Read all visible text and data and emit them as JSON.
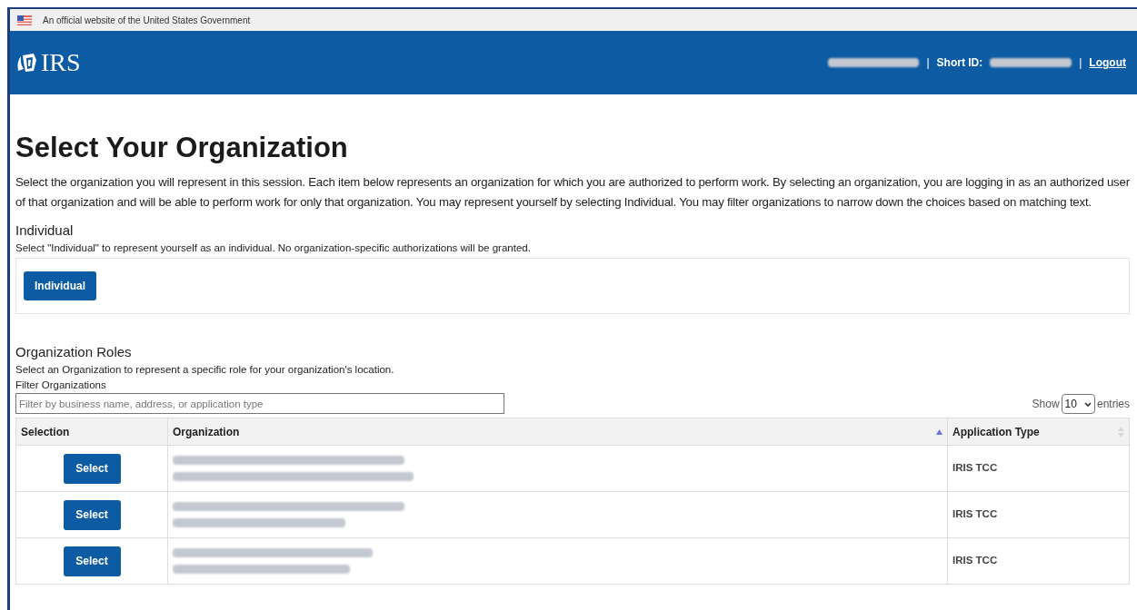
{
  "gov_banner": {
    "text": "An official website of the United States Government"
  },
  "header": {
    "logo": "IRS",
    "short_id_label": "Short ID:",
    "separator": "|",
    "logout": "Logout"
  },
  "page": {
    "title": "Select Your Organization",
    "intro": "Select the organization you will represent in this session. Each item below represents an organization for which you are authorized to perform work. By selecting an organization, you are logging in as an authorized user of that organization and will be able to perform work for only that organization. You may represent yourself by selecting Individual. You may filter organizations to narrow down the choices based on matching text."
  },
  "individual": {
    "heading": "Individual",
    "description": "Select \"Individual\" to represent yourself as an individual. No organization-specific authorizations will be granted.",
    "button": "Individual"
  },
  "roles": {
    "heading": "Organization Roles",
    "description": "Select an Organization to represent a specific role for your organization's location.",
    "filter_label": "Filter Organizations",
    "filter_placeholder": "Filter by business name, address, or application type",
    "show_label": "Show",
    "page_size": "10",
    "entries_label": "entries"
  },
  "table": {
    "columns": [
      {
        "label": "Selection",
        "sortable": false
      },
      {
        "label": "Organization",
        "sortable": true,
        "sorted": true
      },
      {
        "label": "Application Type",
        "sortable": true,
        "sorted": false
      }
    ],
    "rows": [
      {
        "button": "Select",
        "application_type": "IRIS TCC"
      },
      {
        "button": "Select",
        "application_type": "IRIS TCC"
      },
      {
        "button": "Select",
        "application_type": "IRIS TCC"
      }
    ]
  }
}
